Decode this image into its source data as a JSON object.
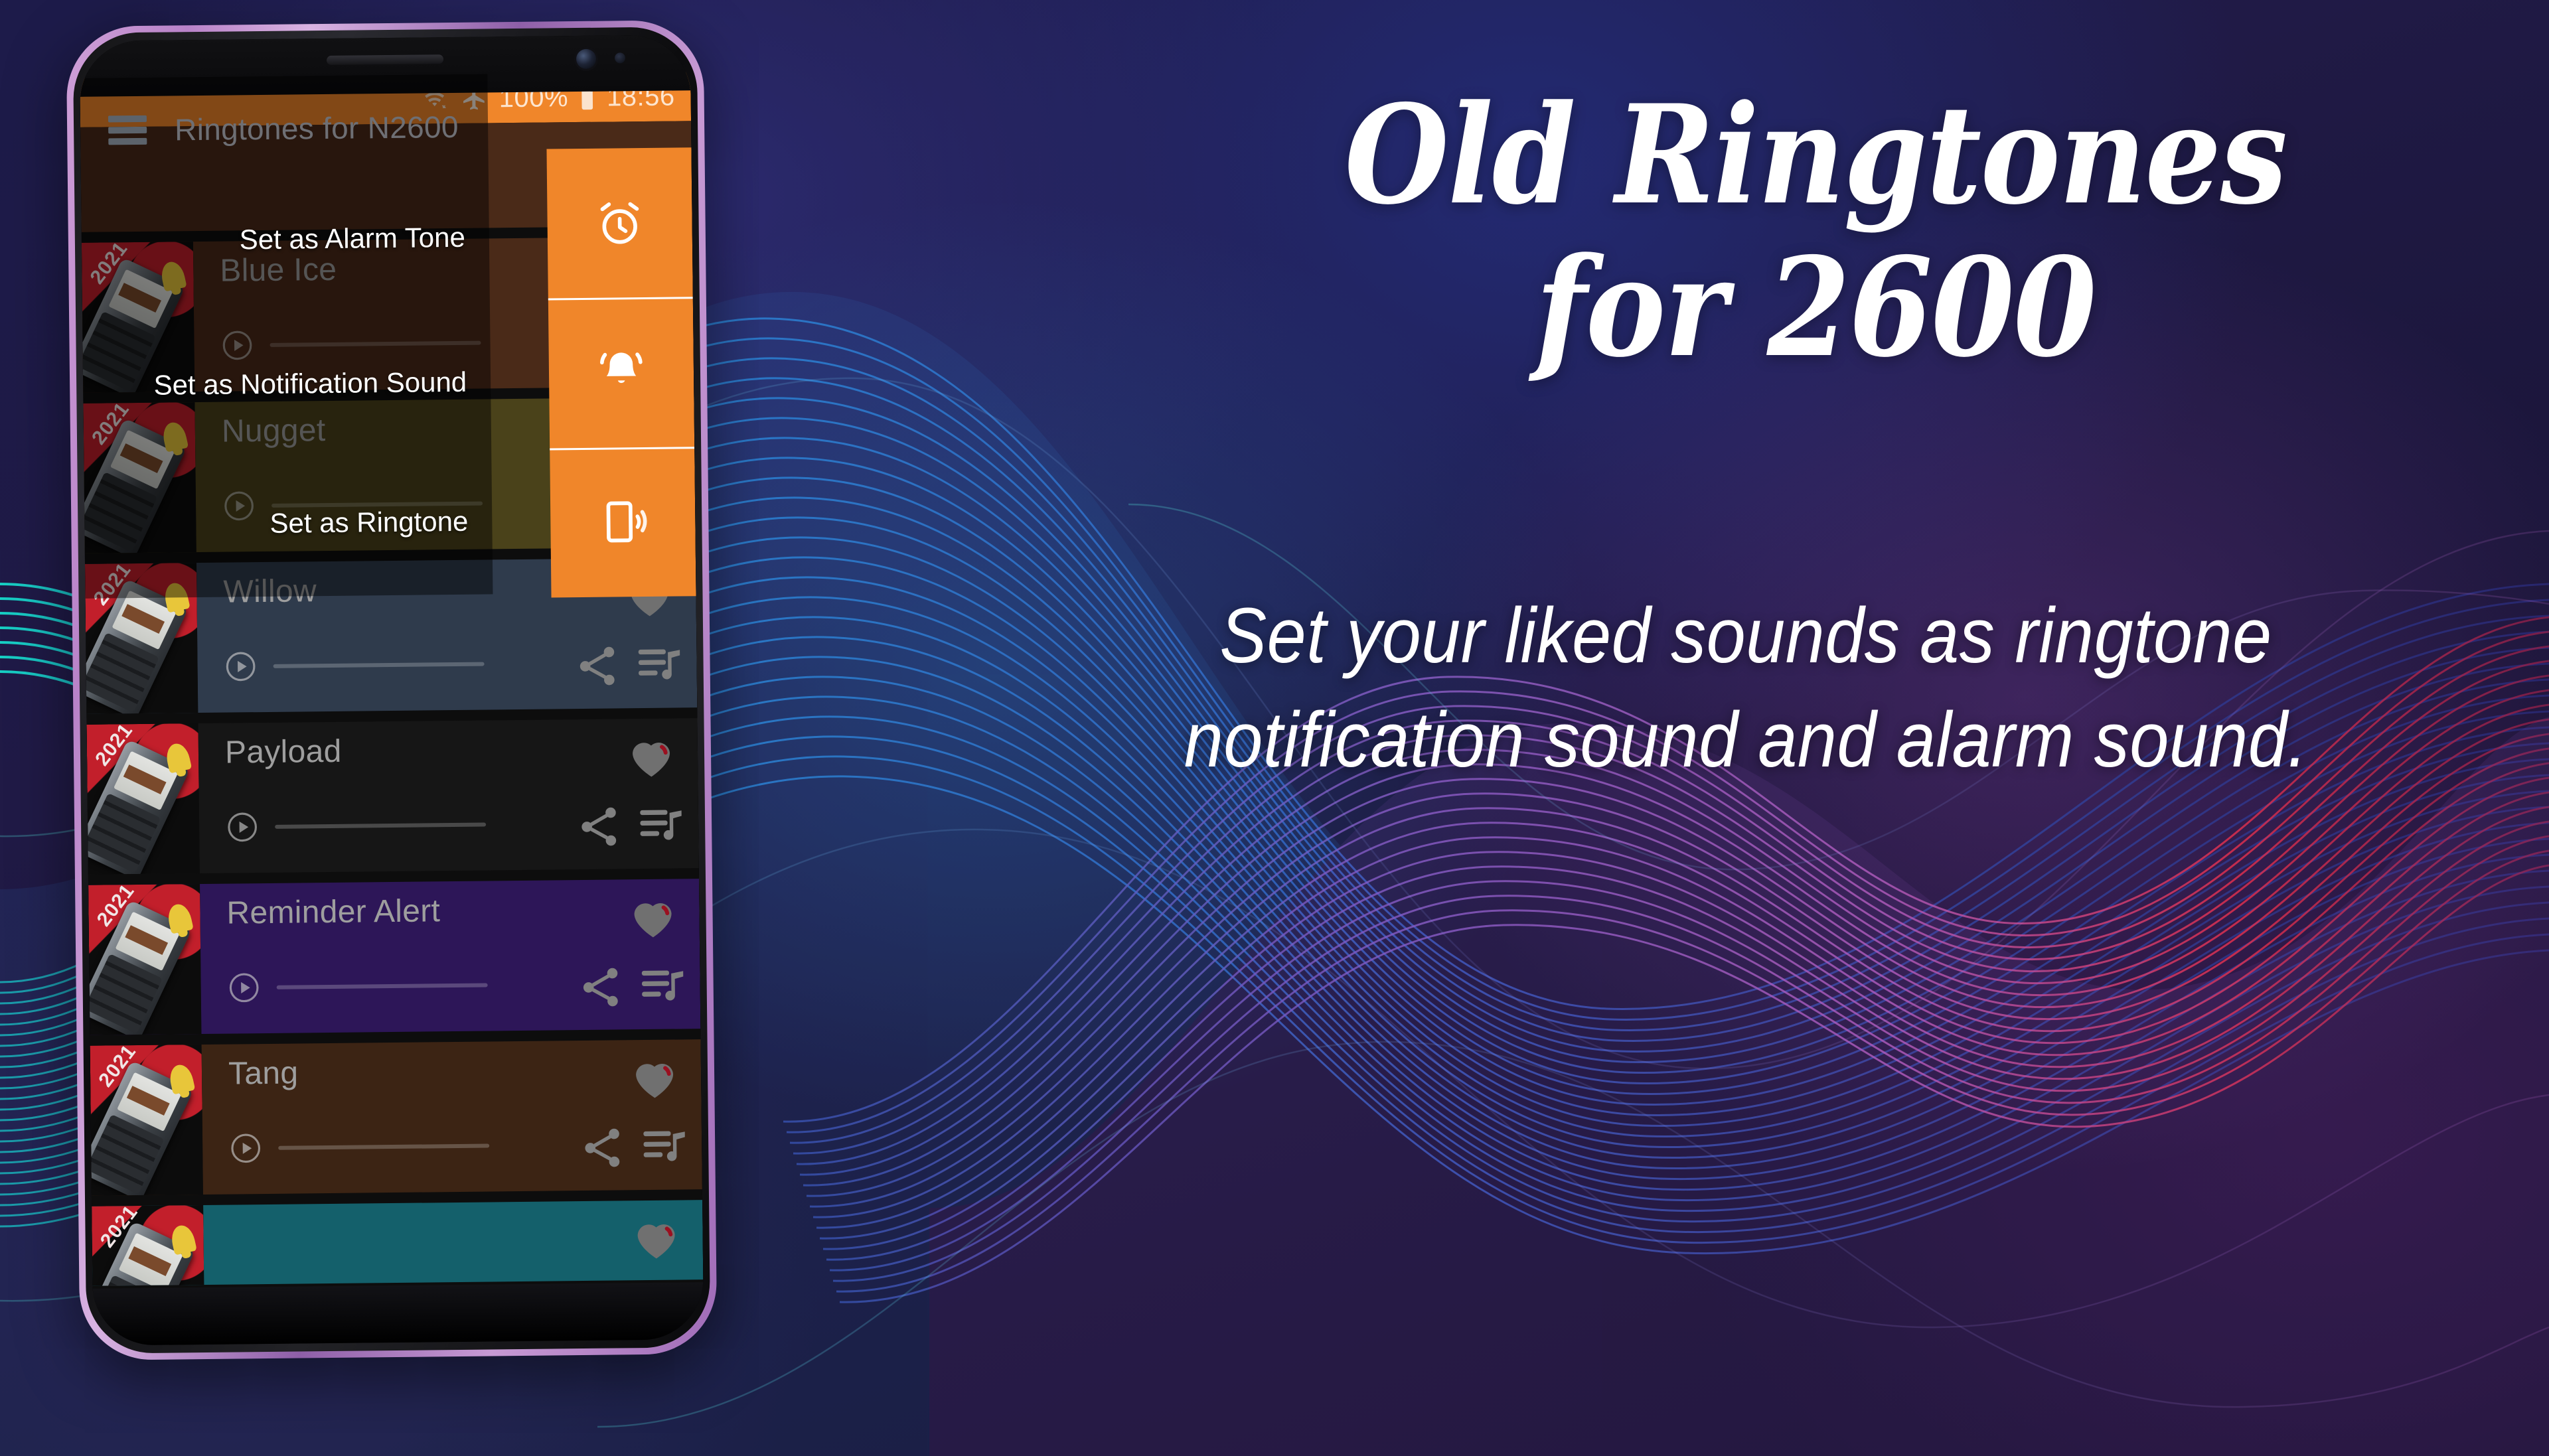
{
  "promo": {
    "headline_line1": "Old Ringtones",
    "headline_line2": "for 2600",
    "subhead_line1": "Set your liked sounds as ringtone",
    "subhead_line2": "notification sound and alarm sound."
  },
  "phone": {
    "status_bar": {
      "wifi_icon": "wifi-icon",
      "airplane_icon": "airplane-mode-icon",
      "battery_percent": "100%",
      "battery_icon": "battery-full-icon",
      "time": "18:56"
    },
    "app_bar": {
      "menu_icon": "hamburger-menu-icon",
      "title": "Ringtones for N2600"
    },
    "dialog": {
      "options": [
        {
          "label": "Set as Alarm Tone",
          "icon": "alarm-clock-icon"
        },
        {
          "label": "Set as Notification Sound",
          "icon": "bell-ring-icon"
        },
        {
          "label": "Set as Ringtone",
          "icon": "phone-vibrate-icon"
        }
      ]
    },
    "tracks": [
      {
        "title": "Blue Ice",
        "row_color": "#4a2a18",
        "favorite": true
      },
      {
        "title": "Nugget",
        "row_color": "#4a421a",
        "favorite": true
      },
      {
        "title": "Willow",
        "row_color": "#2f3b4c",
        "favorite": true
      },
      {
        "title": "Payload",
        "row_color": "#161616",
        "favorite": true
      },
      {
        "title": "Reminder Alert",
        "row_color": "#2d1658",
        "favorite": true
      },
      {
        "title": "Tang",
        "row_color": "#3c2414",
        "favorite": true
      },
      {
        "title": "",
        "row_color": "#14606b",
        "favorite": true
      }
    ],
    "track_icons": {
      "play": "play-circle-icon",
      "favorite": "heart-icon",
      "share": "share-icon",
      "queue": "queue-music-icon"
    },
    "thumbnail_year": "2021"
  },
  "colors": {
    "accent_orange": "#f0862a",
    "background_dark": "#1b1438",
    "wave_blue": "#2f7fd0",
    "wave_cyan": "#16c6c2",
    "wave_purple": "#9c6ccd",
    "wave_red": "#e8314f"
  }
}
